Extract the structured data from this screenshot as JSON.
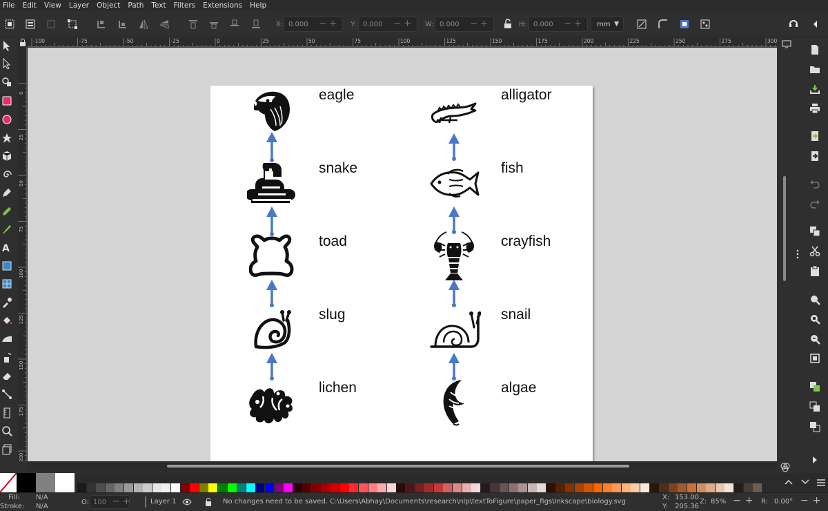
{
  "menubar": [
    "File",
    "Edit",
    "View",
    "Layer",
    "Object",
    "Path",
    "Text",
    "Filters",
    "Extensions",
    "Help"
  ],
  "toolbar": {
    "x_label": "X:",
    "x_value": "0.000",
    "y_label": "Y:",
    "y_value": "0.000",
    "w_label": "W:",
    "w_value": "0.000",
    "h_label": "H:",
    "h_value": "0.000",
    "unit": "mm"
  },
  "ruler": {
    "h_labels": [
      "-100",
      "-75",
      "-50",
      "-25",
      "0",
      "25",
      "50",
      "75",
      "100",
      "125",
      "150",
      "175",
      "200",
      "225",
      "250",
      "275",
      "300"
    ],
    "v_labels": [
      "0",
      "25",
      "50",
      "75",
      "100",
      "125",
      "150",
      "175",
      "200"
    ]
  },
  "diagram": {
    "left_chain": [
      {
        "label": "eagle",
        "icon": "eagle-icon"
      },
      {
        "label": "snake",
        "icon": "snake-icon"
      },
      {
        "label": "toad",
        "icon": "toad-icon"
      },
      {
        "label": "slug",
        "icon": "slug-icon"
      },
      {
        "label": "lichen",
        "icon": "lichen-icon"
      }
    ],
    "right_chain": [
      {
        "label": "alligator",
        "icon": "alligator-icon"
      },
      {
        "label": "fish",
        "icon": "fish-icon"
      },
      {
        "label": "crayfish",
        "icon": "crayfish-icon"
      },
      {
        "label": "snail",
        "icon": "snail-icon"
      },
      {
        "label": "algae",
        "icon": "algae-icon"
      }
    ],
    "arrow_color": "#4a78c8"
  },
  "status": {
    "fill_label": "Fill:",
    "fill_value": "N/A",
    "stroke_label": "Stroke:",
    "stroke_value": "N/A",
    "opacity_label": "O:",
    "opacity_value": "100",
    "layer": "Layer 1",
    "message": "No changes need to be saved. C:\\Users\\Abhay\\Documents\\research\\nlp\\textToFigure\\paper_figs\\Inkscape\\biology.svg",
    "x_label": "X:",
    "x_value": "153.00",
    "y_label": "Y:",
    "y_value": "205.36",
    "zoom_label": "Z:",
    "zoom_value": "85%",
    "rotation_label": "R:",
    "rotation_value": "0.00°"
  }
}
